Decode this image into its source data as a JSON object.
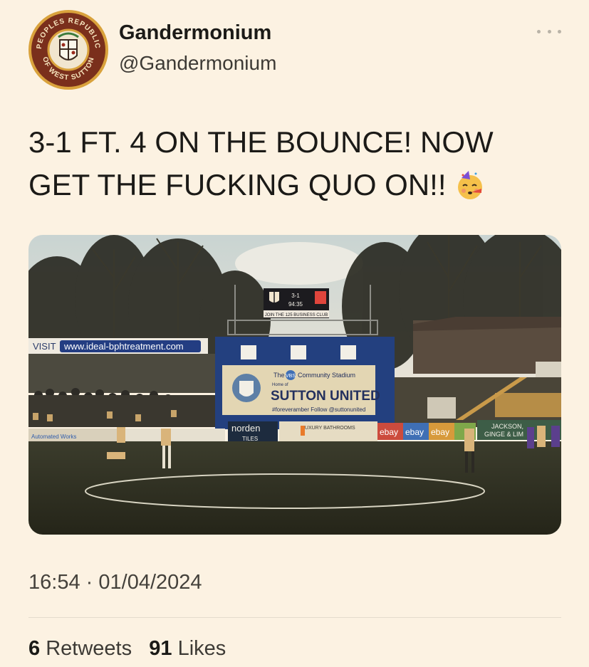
{
  "author": {
    "display_name": "Gandermonium",
    "handle": "@Gandermonium",
    "avatar_text_top": "PEOPLES REPUBLIC",
    "avatar_text_bottom": "OF WEST SUTTON"
  },
  "tweet": {
    "text": "3-1 FT. 4 ON THE BOUNCE! NOW GET THE FUCKING QUO ON!!",
    "emoji": "partying-face-emoji"
  },
  "photo": {
    "scoreboard_score": "3-1",
    "scoreboard_time": "94:35",
    "scoreboard_banner": "JOIN THE 125 BUSINESS CLUB",
    "visit_label": "VISIT",
    "visit_url": "www.ideal-bphtreatment.com",
    "banner_line1_pre": "The",
    "banner_vbs": "VBS",
    "banner_line1_post": "Community Stadium",
    "banner_home_of": "Home of",
    "banner_club": "SUTTON UNITED",
    "banner_footer": "#foreveramber  Follow @suttonunited",
    "ad_norden": "norden",
    "ad_norden_sub": "TILES",
    "ad_bathrooms": "LUXURY BATHROOMS",
    "ad_ebay": "ebay",
    "ad_jackson": "JACKSON,",
    "ad_jackson_sub": "GINGE & LIM",
    "ad_automated": "Automated Works"
  },
  "meta": {
    "time": "16:54",
    "separator": "·",
    "date": "01/04/2024"
  },
  "stats": {
    "retweets_count": "6",
    "retweets_label": "Retweets",
    "likes_count": "91",
    "likes_label": "Likes"
  }
}
